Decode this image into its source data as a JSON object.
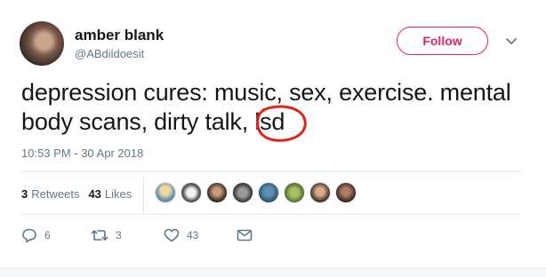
{
  "author": {
    "display_name": "amber blank",
    "screen_name": "@ABdildoesit",
    "follow_label": "Follow"
  },
  "tweet": {
    "text": "depression cures: music, sex, exercise. mental body scans, dirty talk, lsd",
    "timestamp": "10:53 PM - 30 Apr 2018"
  },
  "stats": {
    "retweets_count": "3",
    "retweets_label": "Retweets",
    "likes_count": "43",
    "likes_label": "Likes"
  },
  "actions": {
    "reply_count": "6",
    "retweet_count": "3",
    "like_count": "43"
  },
  "colors": {
    "follow_accent": "#e0245e",
    "annotation": "#e0241b",
    "muted_text": "#657786"
  },
  "icons": [
    "chevron-down-icon",
    "reply-icon",
    "retweet-icon",
    "heart-icon",
    "envelope-icon"
  ]
}
